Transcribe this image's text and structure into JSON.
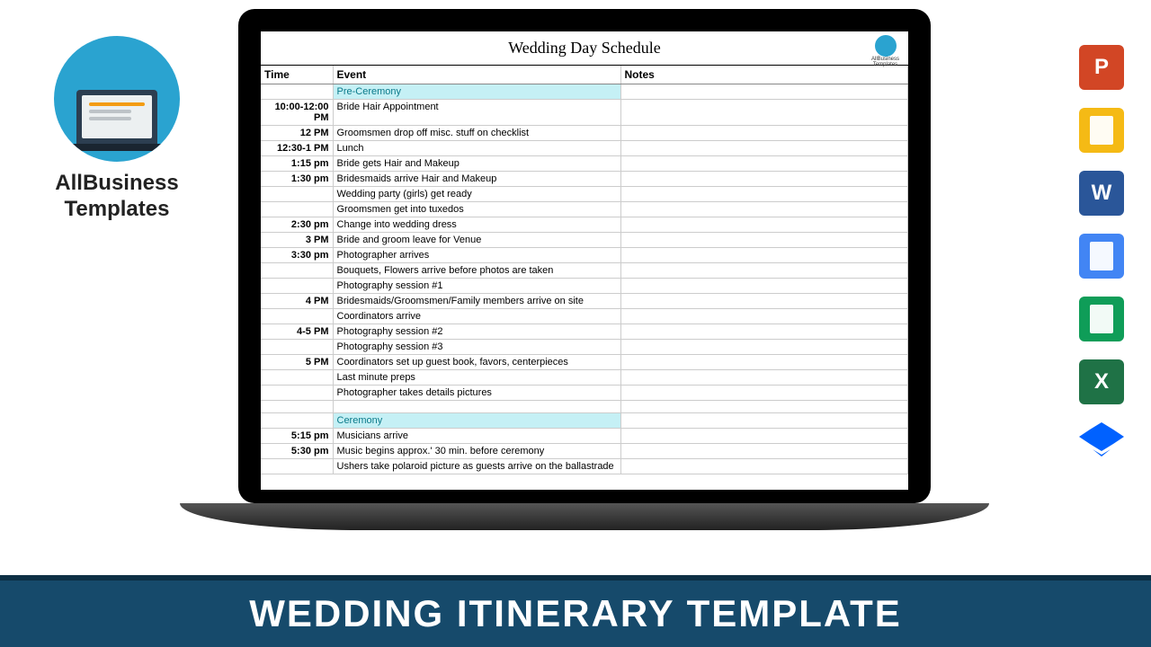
{
  "brand": {
    "name_line1": "AllBusiness",
    "name_line2": "Templates",
    "small_label": "AllBusiness Templates"
  },
  "document": {
    "title": "Wedding Day Schedule",
    "columns": [
      "Time",
      "Event",
      "Notes"
    ],
    "rows": [
      {
        "type": "section",
        "time": "",
        "event": "Pre-Ceremony",
        "notes": ""
      },
      {
        "type": "item",
        "time": "10:00-12:00 PM",
        "event": "Bride Hair Appointment",
        "notes": ""
      },
      {
        "type": "item",
        "time": "12 PM",
        "event": "Groomsmen drop off misc. stuff on checklist",
        "notes": ""
      },
      {
        "type": "item",
        "time": "12:30-1 PM",
        "event": "Lunch",
        "notes": ""
      },
      {
        "type": "item",
        "time": "1:15 pm",
        "event": "Bride gets Hair and Makeup",
        "notes": ""
      },
      {
        "type": "item",
        "time": "1:30 pm",
        "event": "Bridesmaids arrive Hair and Makeup",
        "notes": ""
      },
      {
        "type": "item",
        "time": "",
        "event": "Wedding party (girls) get ready",
        "notes": ""
      },
      {
        "type": "item",
        "time": "",
        "event": "Groomsmen get into tuxedos",
        "notes": ""
      },
      {
        "type": "item",
        "time": "2:30 pm",
        "event": "Change into wedding dress",
        "notes": ""
      },
      {
        "type": "item",
        "time": "3 PM",
        "event": "Bride and groom leave for Venue",
        "notes": ""
      },
      {
        "type": "item",
        "time": "3:30 pm",
        "event": "Photographer arrives",
        "notes": ""
      },
      {
        "type": "item",
        "time": "",
        "event": "Bouquets, Flowers arrive before photos are taken",
        "notes": ""
      },
      {
        "type": "item",
        "time": "",
        "event": "Photography session #1",
        "notes": ""
      },
      {
        "type": "item",
        "time": "4 PM",
        "event": "Bridesmaids/Groomsmen/Family members arrive on site",
        "notes": ""
      },
      {
        "type": "item",
        "time": "",
        "event": "Coordinators arrive",
        "notes": ""
      },
      {
        "type": "item",
        "time": "4-5 PM",
        "event": "Photography session #2",
        "notes": ""
      },
      {
        "type": "item",
        "time": "",
        "event": "Photography session #3",
        "notes": ""
      },
      {
        "type": "item",
        "time": "5 PM",
        "event": "Coordinators set up guest book, favors, centerpieces",
        "notes": ""
      },
      {
        "type": "item",
        "time": "",
        "event": "Last minute preps",
        "notes": ""
      },
      {
        "type": "item",
        "time": "",
        "event": "Photographer takes details pictures",
        "notes": ""
      },
      {
        "type": "blank",
        "time": "",
        "event": "",
        "notes": ""
      },
      {
        "type": "section",
        "time": "",
        "event": "Ceremony",
        "notes": ""
      },
      {
        "type": "item",
        "time": "5:15 pm",
        "event": "Musicians arrive",
        "notes": ""
      },
      {
        "type": "item",
        "time": "5:30 pm",
        "event": "Music begins approx.' 30 min. before ceremony",
        "notes": ""
      },
      {
        "type": "item",
        "time": "",
        "event": "Ushers take polaroid picture as guests arrive on the ballastrade",
        "notes": ""
      }
    ]
  },
  "formats": [
    {
      "name": "powerpoint-icon",
      "letter": "P",
      "bg": "#d24625",
      "shape": "rect"
    },
    {
      "name": "google-slides-icon",
      "letter": "",
      "bg": "#f5ba15",
      "shape": "rect"
    },
    {
      "name": "word-icon",
      "letter": "W",
      "bg": "#2a5699",
      "shape": "rect"
    },
    {
      "name": "google-docs-icon",
      "letter": "",
      "bg": "#4285f4",
      "shape": "rect"
    },
    {
      "name": "google-sheets-icon",
      "letter": "",
      "bg": "#0f9d58",
      "shape": "rect"
    },
    {
      "name": "excel-icon",
      "letter": "X",
      "bg": "#1f7246",
      "shape": "rect"
    },
    {
      "name": "dropbox-icon",
      "letter": "",
      "bg": "#0061ff",
      "shape": "diamond"
    }
  ],
  "footer": {
    "title": "WEDDING ITINERARY TEMPLATE"
  }
}
